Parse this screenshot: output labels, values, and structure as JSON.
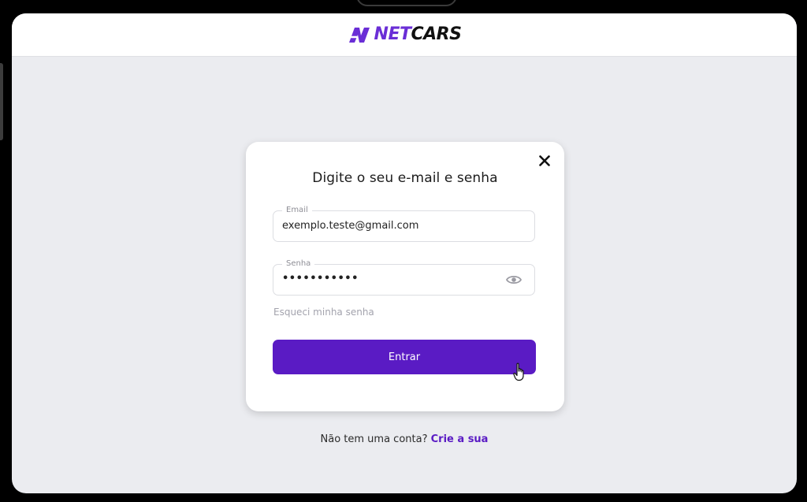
{
  "header": {
    "logo_net": "NET",
    "logo_cars": "CARS"
  },
  "login": {
    "title": "Digite o seu e-mail e senha",
    "email_label": "Email",
    "email_value": "exemplo.teste@gmail.com",
    "password_label": "Senha",
    "password_value": "•••••••••••",
    "forgot_link": "Esqueci minha senha",
    "submit_label": "Entrar"
  },
  "signup": {
    "prompt": "Não tem uma conta?",
    "link": "Crie a sua"
  },
  "colors": {
    "accent": "#5a1bc4",
    "logo_purple": "#6a2ed6",
    "background": "#ebecf0"
  },
  "icons": [
    "netcars-logo-icon",
    "close-icon",
    "eye-icon",
    "hand-cursor-icon"
  ]
}
